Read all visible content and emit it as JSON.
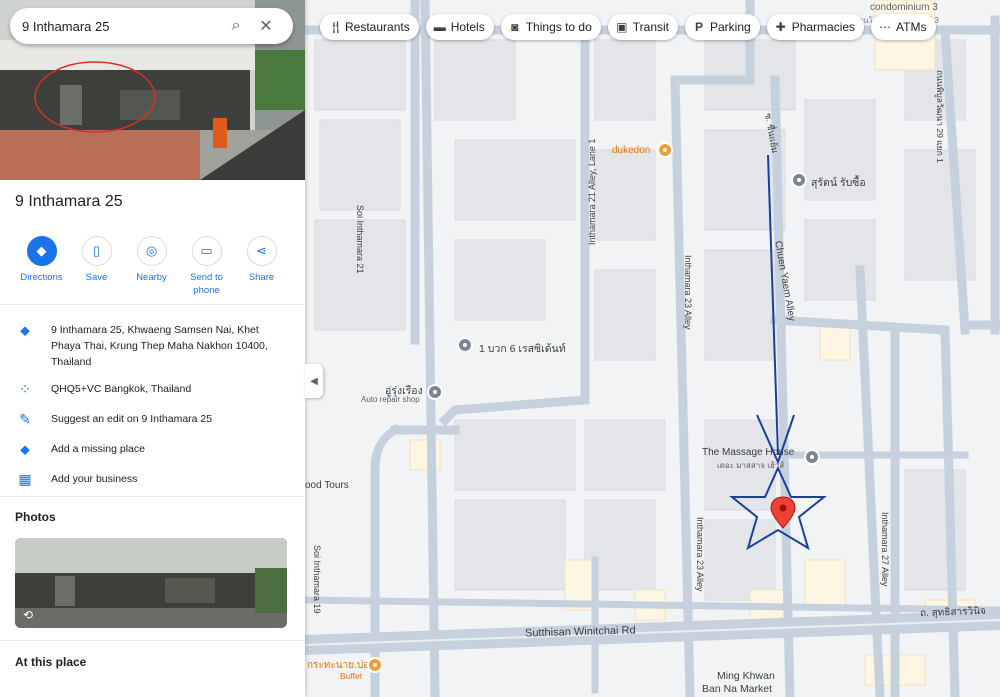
{
  "search": {
    "value": "9 Inthamara 25"
  },
  "place": {
    "title": "9 Inthamara 25",
    "actions": [
      {
        "label": "Directions",
        "icon": "directions-icon"
      },
      {
        "label": "Save",
        "icon": "bookmark-icon"
      },
      {
        "label": "Nearby",
        "icon": "nearby-icon"
      },
      {
        "label": "Send to phone",
        "icon": "phone-icon"
      },
      {
        "label": "Share",
        "icon": "share-icon"
      }
    ],
    "address": "9 Inthamara 25, Khwaeng Samsen Nai, Khet Phaya Thai, Krung Thep Maha Nakhon 10400, Thailand",
    "plus_code": "QHQ5+VC Bangkok, Thailand",
    "suggest_edit": "Suggest an edit on 9 Inthamara 25",
    "add_missing": "Add a missing place",
    "add_business": "Add your business",
    "photos_heading": "Photos",
    "at_place_heading": "At this place"
  },
  "chips": [
    {
      "label": "Restaurants",
      "icon": "fork-knife-icon"
    },
    {
      "label": "Hotels",
      "icon": "bed-icon"
    },
    {
      "label": "Things to do",
      "icon": "camera-icon"
    },
    {
      "label": "Transit",
      "icon": "bus-icon"
    },
    {
      "label": "Parking",
      "icon": "parking-icon"
    },
    {
      "label": "Pharmacies",
      "icon": "pharmacy-icon"
    },
    {
      "label": "ATMs",
      "icon": "atm-icon"
    }
  ],
  "map": {
    "streets": {
      "soi_21": "Soi Inthamara 21",
      "alley_21_lane1": "Inthamara 21 Alley, Lane 1",
      "alley_23": "Inthamara 23 Alley",
      "chuen_yaem": "Chuen Yaem Alley",
      "alley_27": "Inthamara 27 Alley",
      "sutthisan": "Sutthisan Winitchai Rd",
      "soi_19": "Soi Inthamara 19",
      "thai_road": "ถ. สุทธิสารวินิจ",
      "thai_road_top": "ถนนพิบูลวัฒนา 29 แยก 1",
      "thai_alley": "ซ. ชื่นแย้ม"
    },
    "pois": {
      "condo": "condominium 3",
      "condo_thai": "คอนโดมิเนียมทาวเวอร์ 3",
      "dukedon": "dukedon",
      "surat": "สุรัตน์ รับซื้อ",
      "bus6": "1 บวก 6 เรสซิเด้นท์",
      "urung": "อู่รุ่งเรือง",
      "urung_sub": "Auto repair shop",
      "massage": "The Massage House",
      "massage_thai": "เดอะ มาสสาจ เฮ้าส์",
      "tours": "ood Tours",
      "buffet_thai": "กระทะนาย.ปอ",
      "buffet": "Buffet",
      "market": "Ming Khwan",
      "market2": "Ban Na Market"
    }
  },
  "colors": {
    "accent": "#1a73e8",
    "pin": "#ea4335",
    "annotation": "#1c3f9e"
  }
}
